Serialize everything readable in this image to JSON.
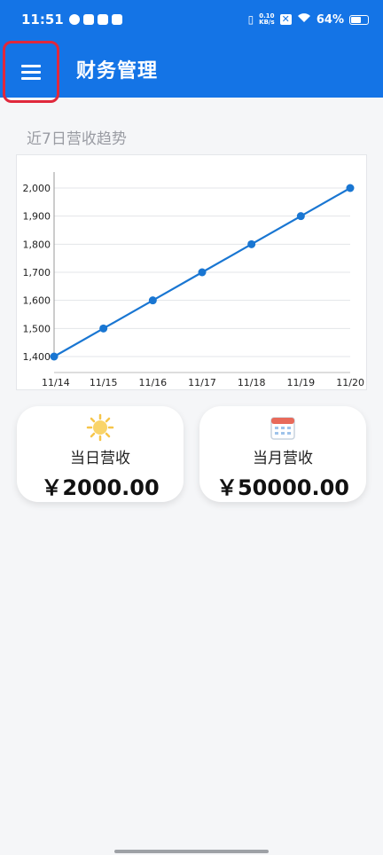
{
  "status_bar": {
    "time": "11:51",
    "net_speed_value": "0.10",
    "net_speed_unit": "KB/s",
    "battery": "64%",
    "battery_level": 0.64,
    "icons": [
      "check-circle-icon",
      "media-icon",
      "app-icon",
      "message-icon",
      "vibrate-icon",
      "no-sim-icon",
      "wifi-icon",
      "battery-icon"
    ]
  },
  "app_bar": {
    "title": "财务管理",
    "menu_icon": "hamburger-menu-icon",
    "color": "#1474e6"
  },
  "trend": {
    "section_title": "近7日营收趋势"
  },
  "chart_data": {
    "type": "line",
    "title": "",
    "xlabel": "",
    "ylabel": "",
    "categories": [
      "11/14",
      "11/15",
      "11/16",
      "11/17",
      "11/18",
      "11/19",
      "11/20"
    ],
    "series": [
      {
        "values": [
          1400,
          1500,
          1600,
          1700,
          1800,
          1900,
          2000
        ]
      }
    ],
    "y_ticks": [
      "1,400",
      "1,500",
      "1,600",
      "1,700",
      "1,800",
      "1,900",
      "2,000"
    ],
    "ylim": [
      1400,
      2000
    ],
    "grid": true,
    "legend": "none",
    "line_color": "#1976d2"
  },
  "stats": {
    "daily": {
      "icon": "sun-icon",
      "label": "当日营收",
      "value": "￥2000.00"
    },
    "monthly": {
      "icon": "calendar-icon",
      "label": "当月营收",
      "value": "￥50000.00"
    }
  }
}
